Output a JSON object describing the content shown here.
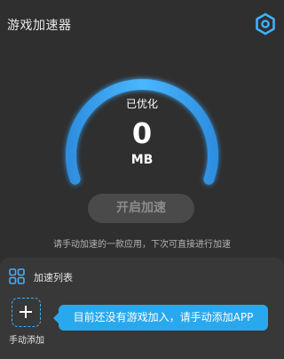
{
  "header": {
    "title": "游戏加速器",
    "settings_icon": "gear-icon"
  },
  "gauge": {
    "status": "已优化",
    "value": "0",
    "unit": "MB",
    "accent_color": "#3fb0ff"
  },
  "accelerate_button": {
    "label": "开启加速"
  },
  "hint": "请手动加速的一款应用，下次可直接进行加速",
  "list": {
    "title": "加速列表",
    "icon": "grid-icon",
    "add_label": "手动添加",
    "empty_tip": "目前还没有游戏加入，请手动添加APP"
  }
}
